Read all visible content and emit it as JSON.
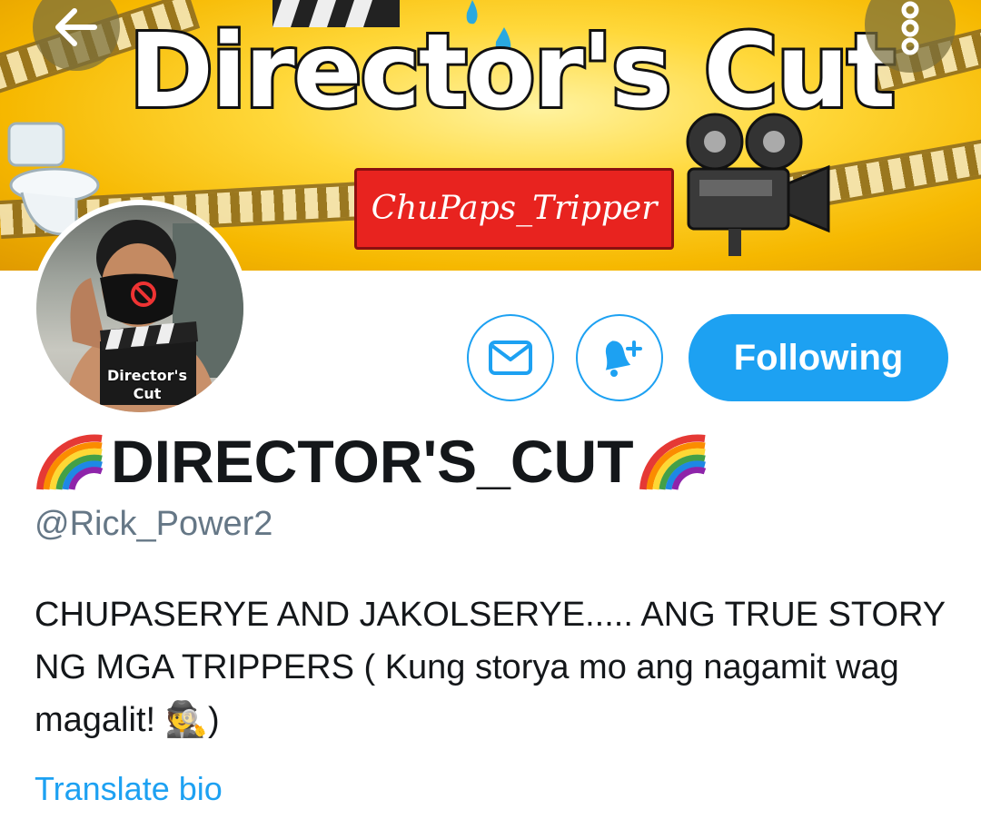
{
  "banner": {
    "title": "Director's Cut",
    "subtitle": "ChuPaps_Tripper"
  },
  "nav": {
    "back_icon": "arrow-left-icon",
    "more_icon": "more-vertical-icon"
  },
  "avatar": {
    "label_line1": "Director's",
    "label_line2": "Cut"
  },
  "actions": {
    "message_icon": "envelope-icon",
    "notify_icon": "bell-plus-icon",
    "follow_label": "Following"
  },
  "profile": {
    "display_name": "DIRECTOR'S_CUT",
    "handle": "@Rick_Power2",
    "bio_text": "CHUPASERYE AND JAKOLSERYE..... ANG TRUE STORY NG MGA TRIPPERS ( Kung storya mo ang nagamit wag magalit! ",
    "bio_emoji": "🕵",
    "bio_end": ")",
    "translate_label": "Translate bio"
  },
  "colors": {
    "accent": "#1da1f2",
    "text_primary": "#14171a",
    "text_secondary": "#657786",
    "banner_yellow": "#ffd83a",
    "banner_red": "#e8231f"
  }
}
